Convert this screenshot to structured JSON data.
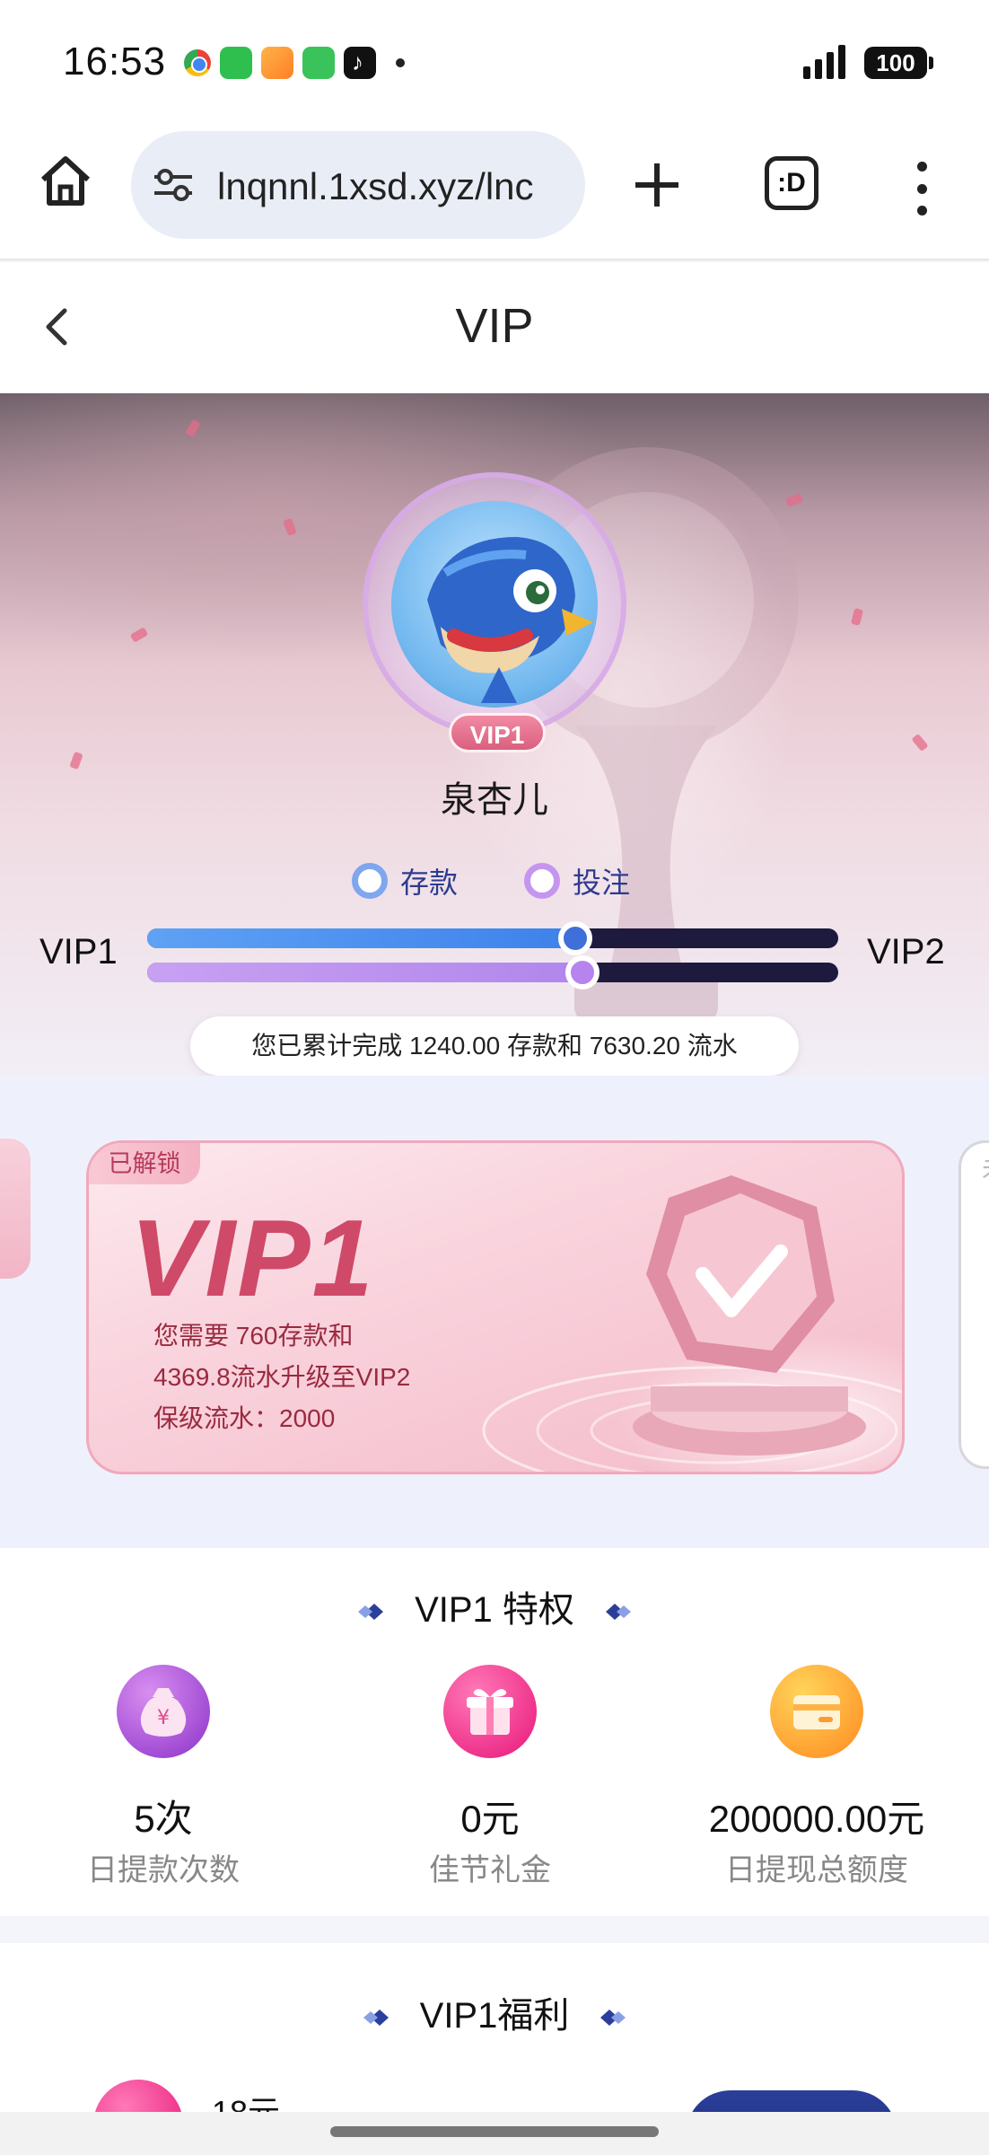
{
  "status_bar": {
    "time": "16:53",
    "app_icons": [
      "chrome-icon",
      "messages-icon",
      "video-app-icon",
      "phone-icon",
      "tiktok-icon"
    ],
    "battery": "100",
    "signal_bars": 4
  },
  "browser": {
    "url": "lnqnnl.1xsd.xyz/lnc",
    "tabs_label": ":D",
    "icons": [
      "home-icon",
      "site-settings-icon",
      "new-tab-icon",
      "tabs-icon",
      "more-vert-icon"
    ]
  },
  "header": {
    "title": "VIP",
    "back_icon": "chevron-left-icon"
  },
  "profile": {
    "level_badge": "VIP1",
    "username": "泉杏儿"
  },
  "progress": {
    "legend": [
      {
        "label": "存款",
        "color": "#7fa6ee"
      },
      {
        "label": "投注",
        "color": "#c496ef"
      }
    ],
    "from_level": "VIP1",
    "to_level": "VIP2",
    "deposit_fraction": 0.62,
    "bet_fraction": 0.63,
    "summary": "您已累计完成 1240.00 存款和 7630.20 流水"
  },
  "card": {
    "status_tag": "已解锁",
    "level": "VIP1",
    "lines": [
      "您需要  760存款和",
      "4369.8流水升级至VIP2",
      "保级流水：2000"
    ],
    "next_card_partial": "未"
  },
  "privileges": {
    "title": "VIP1 特权",
    "items": [
      {
        "icon": "money-bag-icon",
        "value": "5次",
        "label": "日提款次数"
      },
      {
        "icon": "gift-icon",
        "value": "0元",
        "label": "佳节礼金"
      },
      {
        "icon": "wallet-card-icon",
        "value": "200000.00元",
        "label": "日提现总额度"
      }
    ]
  },
  "benefits": {
    "title": "VIP1福利",
    "first_amount": "18元"
  },
  "colors": {
    "accent_navy": "#1d1a3e",
    "deposit_bar": "#3d82ea",
    "bet_bar": "#b186ec",
    "card_pink": "#cf4a68"
  }
}
